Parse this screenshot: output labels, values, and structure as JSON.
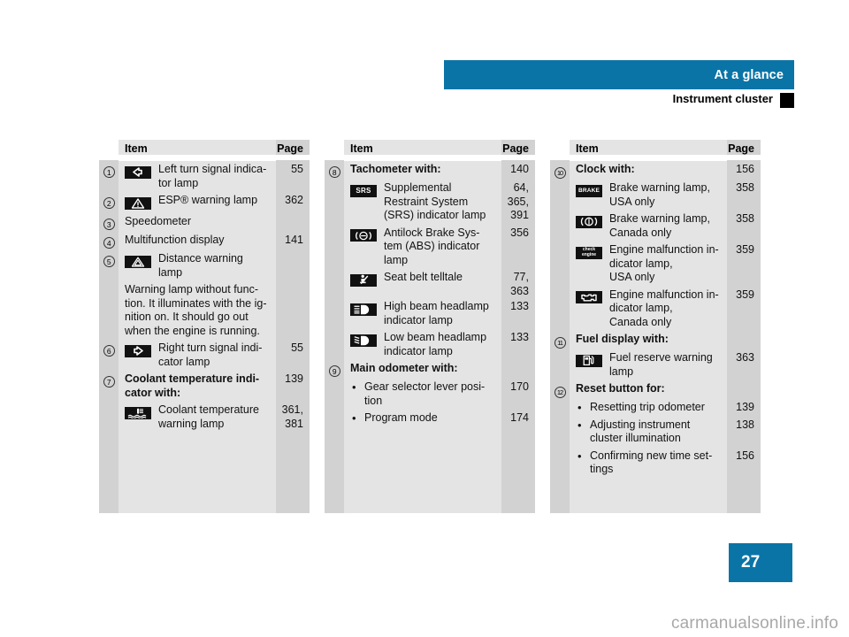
{
  "header": {
    "chapter_title": "At a glance",
    "section_title": "Instrument cluster"
  },
  "footer": {
    "page_number": "27",
    "watermark": "carmanualsonline.info"
  },
  "table_headers": {
    "item": "Item",
    "page": "Page"
  },
  "columns": [
    {
      "id": "column-1",
      "rows": [
        {
          "num": "1",
          "icon": "left-turn-signal-icon",
          "text": "Left turn signal indica-\ntor lamp",
          "page": "55"
        },
        {
          "num": "2",
          "icon": "esp-warning-triangle-icon",
          "text": "ESP® warning lamp",
          "page": "362"
        },
        {
          "num": "3",
          "icon": null,
          "text": "Speedometer",
          "page": ""
        },
        {
          "num": "4",
          "icon": null,
          "text": "Multifunction display",
          "page": "141"
        },
        {
          "num": "5",
          "icon": "distance-warning-icon",
          "text": "Distance warning\nlamp",
          "page": ""
        },
        {
          "num": "",
          "icon": null,
          "text": "Warning lamp without func-\ntion. It illuminates with the ig-\nnition on. It should go out\nwhen the engine is running.",
          "page": ""
        },
        {
          "num": "6",
          "icon": "right-turn-signal-icon",
          "text": "Right turn signal indi-\ncator lamp",
          "page": "55"
        },
        {
          "num": "7",
          "icon": null,
          "bold": true,
          "text": "Coolant temperature indi-\ncator with:",
          "page": "139"
        },
        {
          "num": "",
          "icon": "coolant-temperature-icon",
          "text": "Coolant temperature\nwarning lamp",
          "page": "361,\n381"
        }
      ]
    },
    {
      "id": "column-2",
      "rows": [
        {
          "num": "8",
          "icon": null,
          "bold": true,
          "text": "Tachometer with:",
          "page": "140"
        },
        {
          "num": "",
          "icon": "srs-indicator-icon",
          "text": "Supplemental\nRestraint System\n(SRS) indicator lamp",
          "page": "64,\n365,\n391"
        },
        {
          "num": "",
          "icon": "abs-indicator-icon",
          "text": "Antilock Brake Sys-\ntem (ABS) indicator\nlamp",
          "page": "356"
        },
        {
          "num": "",
          "icon": "seat-belt-telltale-icon",
          "text": "Seat belt telltale",
          "page": "77,\n363"
        },
        {
          "num": "",
          "icon": "high-beam-headlamp-icon",
          "text": "High beam headlamp\nindicator lamp",
          "page": "133"
        },
        {
          "num": "",
          "icon": "low-beam-headlamp-icon",
          "text": "Low beam headlamp\nindicator lamp",
          "page": "133"
        },
        {
          "num": "9",
          "icon": null,
          "bold": true,
          "text": "Main odometer with:",
          "page": ""
        },
        {
          "num": "",
          "bullet": true,
          "text": "Gear selector lever posi-\ntion",
          "page": "170"
        },
        {
          "num": "",
          "bullet": true,
          "text": "Program mode",
          "page": "174"
        }
      ]
    },
    {
      "id": "column-3",
      "rows": [
        {
          "num": "10",
          "icon": null,
          "bold": true,
          "text": "Clock with:",
          "page": "156"
        },
        {
          "num": "",
          "icon": "brake-warning-usa-icon",
          "text": "Brake warning lamp,\nUSA only",
          "page": "358"
        },
        {
          "num": "",
          "icon": "brake-warning-canada-icon",
          "text": "Brake warning lamp,\nCanada only",
          "page": "358"
        },
        {
          "num": "",
          "icon": "check-engine-usa-icon",
          "text": "Engine malfunction in-\ndicator lamp,\nUSA only",
          "page": "359"
        },
        {
          "num": "",
          "icon": "engine-malfunction-canada-icon",
          "text": "Engine malfunction in-\ndicator lamp,\nCanada only",
          "page": "359"
        },
        {
          "num": "11",
          "icon": null,
          "bold": true,
          "text": "Fuel display with:",
          "page": ""
        },
        {
          "num": "",
          "icon": "fuel-reserve-warning-icon",
          "text": "Fuel reserve warning\nlamp",
          "page": "363"
        },
        {
          "num": "12",
          "icon": null,
          "bold": true,
          "text": "Reset button for:",
          "page": ""
        },
        {
          "num": "",
          "bullet": true,
          "text": "Resetting trip odometer",
          "page": "139"
        },
        {
          "num": "",
          "bullet": true,
          "text": "Adjusting instrument\ncluster illumination",
          "page": "138"
        },
        {
          "num": "",
          "bullet": true,
          "text": "Confirming new time set-\ntings",
          "page": "156"
        }
      ]
    }
  ],
  "colors": {
    "accent_blue": "#0a74a6",
    "cell_light": "#e4e4e4",
    "cell_dark": "#d2d2d2",
    "icon_black": "#111111"
  }
}
